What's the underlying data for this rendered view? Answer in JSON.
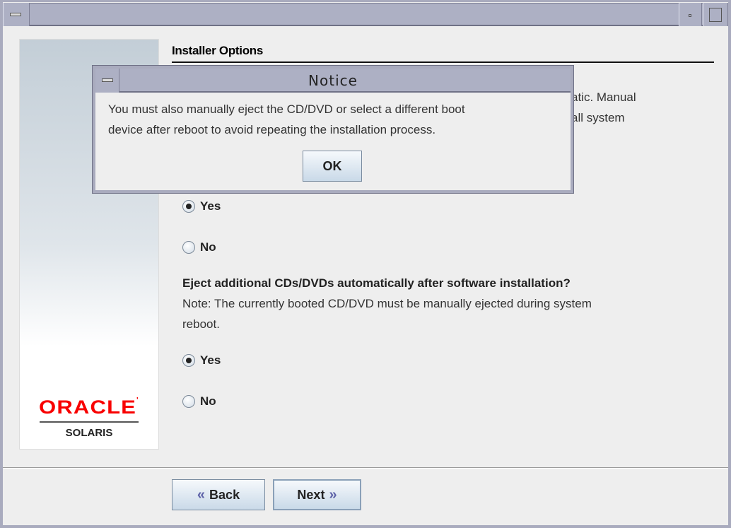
{
  "window": {
    "title": ""
  },
  "sidebar": {
    "logo_brand": "ORACLE",
    "logo_product": "SOLARIS",
    "brand_color": "#f80000"
  },
  "main": {
    "heading": "Installer Options",
    "obscured_text_line1": "atic.  Manual",
    "obscured_text_line2": "all system",
    "group1": {
      "options": [
        {
          "label": "Yes",
          "selected": true
        },
        {
          "label": "No",
          "selected": false
        }
      ]
    },
    "group2": {
      "question": "Eject additional CDs/DVDs automatically after software installation?",
      "note_line1": "Note: The currently booted CD/DVD must be manually ejected during system",
      "note_line2": "reboot.",
      "options": [
        {
          "label": "Yes",
          "selected": true
        },
        {
          "label": "No",
          "selected": false
        }
      ]
    }
  },
  "footer": {
    "back_label": "Back",
    "next_label": "Next"
  },
  "dialog": {
    "title": "Notice",
    "message_line1": "You must also manually eject the CD/DVD or select a different boot",
    "message_line2": "device after reboot to avoid repeating the installation process.",
    "ok_label": "OK"
  }
}
